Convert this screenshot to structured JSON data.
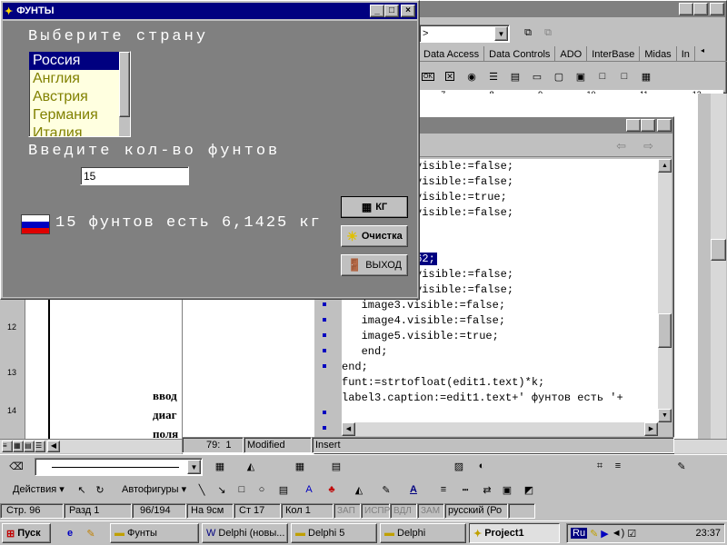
{
  "delphi_main": {
    "combo_value": ">",
    "tabs": [
      "Data Access",
      "Data Controls",
      "ADO",
      "InterBase",
      "Midas",
      "In"
    ],
    "ruler": [
      "7",
      "8",
      "9",
      "10",
      "11",
      "12"
    ]
  },
  "code_editor": {
    "lines": [
      "visible:=false;",
      "visible:=false;",
      "visible:=true;",
      "visible:=false;",
      "",
      "",
      "762;",
      "visible:=false;",
      "visible:=false;",
      "   image3.visible:=false;",
      "   image4.visible:=false;",
      "   image5.visible:=true;",
      "   end;",
      "end;",
      "funt:=strtofloat(edit1.text)*k;",
      "label3.caption:=edit1.text+' фунтов есть '+"
    ],
    "status": {
      "position": "79:  1",
      "modified": "Modified",
      "mode": "Insert"
    }
  },
  "word": {
    "body_text": [
      "ввод",
      "диаг",
      "поля"
    ],
    "draw_toolbar": {
      "actions": "Действия",
      "autoshapes": "Автофигуры"
    },
    "status": {
      "page": "Стр. 96",
      "section": "Разд 1",
      "pages": "96/194",
      "at": "На 9см",
      "line": "Ст 17",
      "col": "Кол 1",
      "rec": "ЗАП",
      "trk": "ИСПР",
      "ext": "ВДЛ",
      "ovr": "ЗАМ",
      "lang": "русский (Ро"
    },
    "ruler_numbers": [
      "12",
      "13",
      "14"
    ]
  },
  "funty_form": {
    "title": "ФУНТЫ",
    "choose_country": "Выберите страну",
    "countries": [
      "Россия",
      "Англия",
      "Австрия",
      "Германия",
      "Италия"
    ],
    "selected_index": 0,
    "enter_pounds": "Введите кол-во фунтов",
    "input_value": "15",
    "result": "15 фунтов есть 6,1425 кг",
    "buttons": {
      "kg": "КГ",
      "clear": "Очистка",
      "exit": "ВЫХОД"
    }
  },
  "taskbar": {
    "start": "Пуск",
    "tasks": [
      "Фунты",
      "Delphi (новы...",
      "Delphi 5",
      "Delphi",
      "Project1"
    ],
    "active_task_index": 4,
    "lang": "Ru",
    "clock": "23:37"
  }
}
